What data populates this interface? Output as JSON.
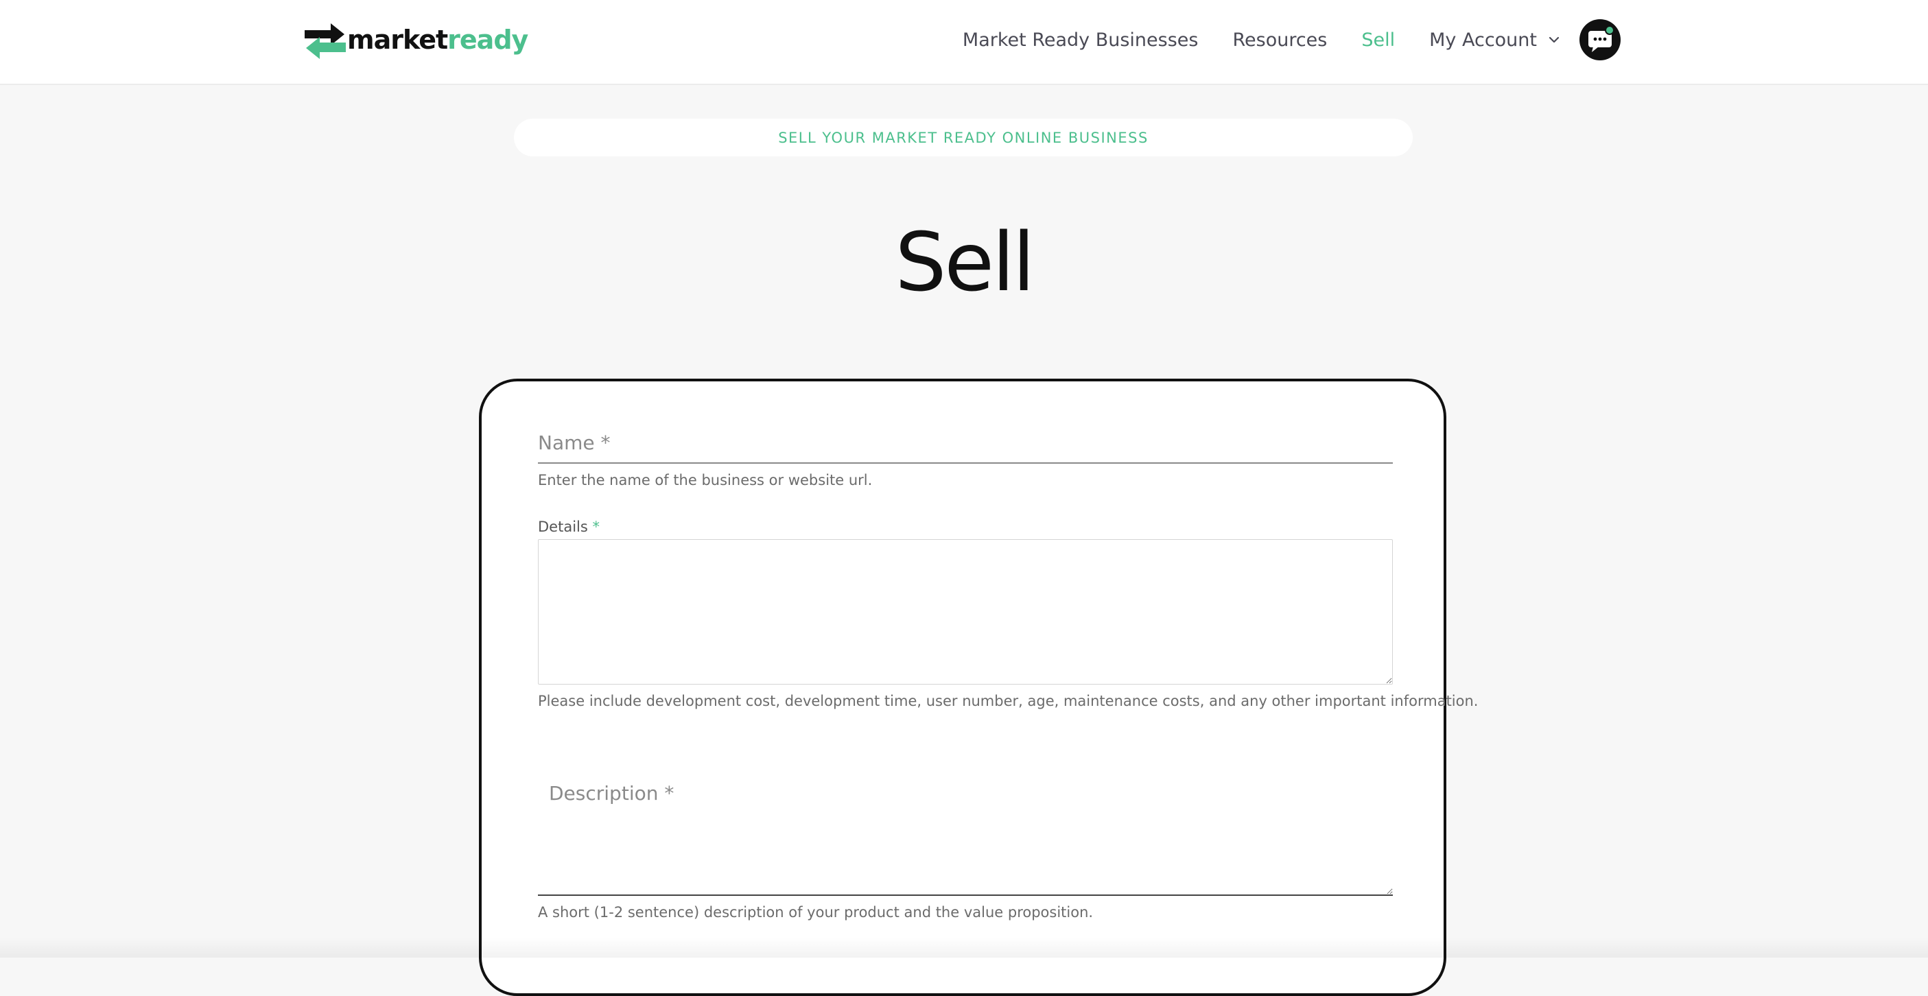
{
  "header": {
    "logo": {
      "part1": "market",
      "part2": "ready"
    },
    "nav": {
      "items": [
        {
          "label": "Market Ready Businesses",
          "active": false
        },
        {
          "label": "Resources",
          "active": false
        },
        {
          "label": "Sell",
          "active": true
        }
      ],
      "account_label": "My Account",
      "chat_icon": "chat-icon"
    }
  },
  "eyebrow": "SELL YOUR MARKET READY ONLINE BUSINESS",
  "page_title": "Sell",
  "form": {
    "name": {
      "placeholder": "Name *",
      "value": "",
      "help": "Enter the name of the business or website url."
    },
    "details": {
      "label": "Details",
      "required_mark": "*",
      "value": "",
      "help": "Please include development cost, development time, user number, age, maintenance costs, and any other important information."
    },
    "description": {
      "placeholder": "Description *",
      "value": "",
      "help": "A short (1-2 sentence) description of your product and the value proposition."
    }
  },
  "colors": {
    "accent": "#4cbf8d",
    "text_dark": "#111111",
    "page_bg": "#f7f7f7"
  }
}
